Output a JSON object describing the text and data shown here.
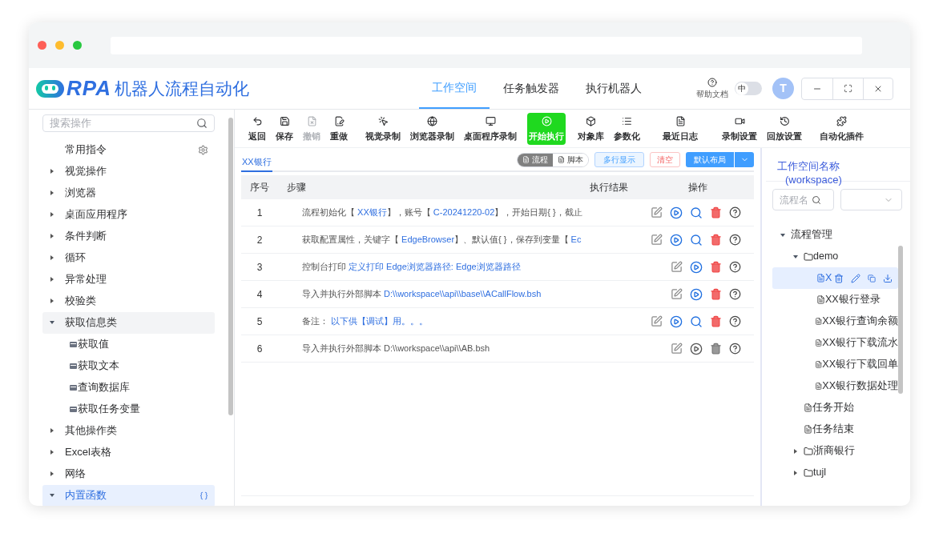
{
  "app": {
    "logo_text": "RPA",
    "title": "机器人流程自动化"
  },
  "nav_tabs": [
    {
      "label": "工作空间",
      "selected": true
    },
    {
      "label": "任务触发器",
      "selected": false
    },
    {
      "label": "执行机器人",
      "selected": false
    }
  ],
  "help": {
    "label": "帮助文档"
  },
  "language_toggle": {
    "label": "中",
    "on": false
  },
  "avatar": {
    "initial": "T"
  },
  "sidebar": {
    "search": {
      "placeholder": "搜索操作"
    },
    "items": [
      {
        "label": "常用指令",
        "kind": "pinned",
        "selected": false,
        "hovered": false
      },
      {
        "label": "视觉操作",
        "kind": "group",
        "expanded": false,
        "selected": false,
        "hovered": false
      },
      {
        "label": "浏览器",
        "kind": "group",
        "expanded": false,
        "selected": false,
        "hovered": false
      },
      {
        "label": "桌面应用程序",
        "kind": "group",
        "expanded": false,
        "selected": false,
        "hovered": false
      },
      {
        "label": "条件判断",
        "kind": "group",
        "expanded": false,
        "selected": false,
        "hovered": false
      },
      {
        "label": "循环",
        "kind": "group",
        "expanded": false,
        "selected": false,
        "hovered": false
      },
      {
        "label": "异常处理",
        "kind": "group",
        "expanded": false,
        "selected": false,
        "hovered": false
      },
      {
        "label": "校验类",
        "kind": "group",
        "expanded": false,
        "selected": false,
        "hovered": false
      },
      {
        "label": "获取信息类",
        "kind": "group",
        "expanded": true,
        "selected": false,
        "hovered": true,
        "children": [
          {
            "label": "获取值"
          },
          {
            "label": "获取文本"
          },
          {
            "label": "查询数据库"
          },
          {
            "label": "获取任务变量"
          }
        ]
      },
      {
        "label": "其他操作类",
        "kind": "group",
        "expanded": false,
        "selected": false,
        "hovered": false
      },
      {
        "label": "Excel表格",
        "kind": "group",
        "expanded": false,
        "selected": false,
        "hovered": false
      },
      {
        "label": "网络",
        "kind": "group",
        "expanded": false,
        "selected": false,
        "hovered": false
      },
      {
        "label": "内置函数",
        "kind": "group",
        "expanded": true,
        "selected": true,
        "hovered": false
      }
    ]
  },
  "toolbar": [
    {
      "label": "返回",
      "disabled": false,
      "highlighted": false
    },
    {
      "label": "保存",
      "disabled": false,
      "highlighted": false
    },
    {
      "label": "撤销",
      "disabled": true,
      "highlighted": false
    },
    {
      "label": "重做",
      "disabled": false,
      "highlighted": false
    },
    {
      "label": "视觉录制",
      "disabled": false,
      "highlighted": false
    },
    {
      "label": "浏览器录制",
      "disabled": false,
      "highlighted": false
    },
    {
      "label": "桌面程序录制",
      "disabled": false,
      "highlighted": false
    },
    {
      "label": "开始执行",
      "disabled": false,
      "highlighted": true
    },
    {
      "label": "对象库",
      "disabled": false,
      "highlighted": false
    },
    {
      "label": "参数化",
      "disabled": false,
      "highlighted": false
    },
    {
      "label": "最近日志",
      "disabled": false,
      "highlighted": false
    },
    {
      "label": "录制设置",
      "disabled": false,
      "highlighted": false
    },
    {
      "label": "回放设置",
      "disabled": false,
      "highlighted": false
    },
    {
      "label": "自动化插件",
      "disabled": false,
      "highlighted": false
    }
  ],
  "editor": {
    "tabs": [
      {
        "label": "XX银行",
        "selected": true
      }
    ],
    "view_toggle": [
      {
        "label": "流程",
        "selected": true
      },
      {
        "label": "脚本",
        "selected": false
      }
    ],
    "buttons": [
      {
        "label": "多行显示",
        "kind": "secondary"
      },
      {
        "label": "清空",
        "kind": "danger"
      },
      {
        "label": "默认布局",
        "kind": "primary"
      }
    ],
    "table": {
      "columns": [
        "序号",
        "步骤",
        "执行结果",
        "操作"
      ],
      "rows": [
        {
          "index": "1",
          "disabled": false,
          "inspectable": true,
          "step": [
            {
              "text": "流程初始化【 ",
              "link": false
            },
            {
              "text": "XX银行",
              "link": true
            },
            {
              "text": "】，账号【 ",
              "link": false
            },
            {
              "text": "C-20241220-02",
              "link": true
            },
            {
              "text": "】，开始日期{ }，截止",
              "link": false
            }
          ]
        },
        {
          "index": "2",
          "disabled": false,
          "inspectable": true,
          "step": [
            {
              "text": "获取配置属性，关键字【 ",
              "link": false
            },
            {
              "text": "EdgeBrowser",
              "link": true
            },
            {
              "text": "】、默认值{ }，保存到变量【 ",
              "link": false
            },
            {
              "text": "Ec",
              "link": true
            }
          ]
        },
        {
          "index": "3",
          "disabled": false,
          "inspectable": false,
          "step": [
            {
              "text": "控制台打印 ",
              "link": false
            },
            {
              "text": "定义打印 Edge浏览器路径: Edge浏览器路径",
              "link": true
            }
          ]
        },
        {
          "index": "4",
          "disabled": false,
          "inspectable": false,
          "step": [
            {
              "text": "导入并执行外部脚本 ",
              "link": false
            },
            {
              "text": "D:\\\\workspace\\\\api\\\\base\\\\ACallFlow.bsh",
              "link": true
            }
          ]
        },
        {
          "index": "5",
          "disabled": false,
          "inspectable": true,
          "step": [
            {
              "text": "备注： ",
              "link": false
            },
            {
              "text": "以下供【调试】用。。。",
              "link": true
            }
          ]
        },
        {
          "index": "6",
          "disabled": true,
          "inspectable": false,
          "step": [
            {
              "text": "导入并执行外部脚本 D:\\\\workspace\\\\api\\\\AB.bsh",
              "link": false
            }
          ]
        }
      ]
    }
  },
  "workspace": {
    "title": "工作空间名称",
    "subtitle": "(workspace)",
    "search": {
      "placeholder": "流程名"
    },
    "tree": [
      {
        "label": "流程管理",
        "kind": "group",
        "expanded": true,
        "selected": false,
        "children": [
          {
            "label": "demo",
            "kind": "folder",
            "expanded": true,
            "selected": false,
            "children": [
              {
                "label": "X",
                "kind": "file",
                "selected": true
              },
              {
                "label": "XX银行登录",
                "kind": "file",
                "selected": false
              },
              {
                "label": "XX银行查询余额",
                "kind": "file",
                "selected": false
              },
              {
                "label": "XX银行下载流水",
                "kind": "file",
                "selected": false
              },
              {
                "label": "XX银行下载回单",
                "kind": "file",
                "selected": false
              },
              {
                "label": "XX银行数据处理",
                "kind": "file",
                "selected": false
              }
            ]
          },
          {
            "label": "任务开始",
            "kind": "file",
            "selected": false
          },
          {
            "label": "任务结束",
            "kind": "file",
            "selected": false
          },
          {
            "label": "浙商银行",
            "kind": "folder",
            "expanded": false,
            "selected": false
          },
          {
            "label": "tujl",
            "kind": "folder",
            "expanded": false,
            "selected": false
          }
        ]
      }
    ]
  }
}
